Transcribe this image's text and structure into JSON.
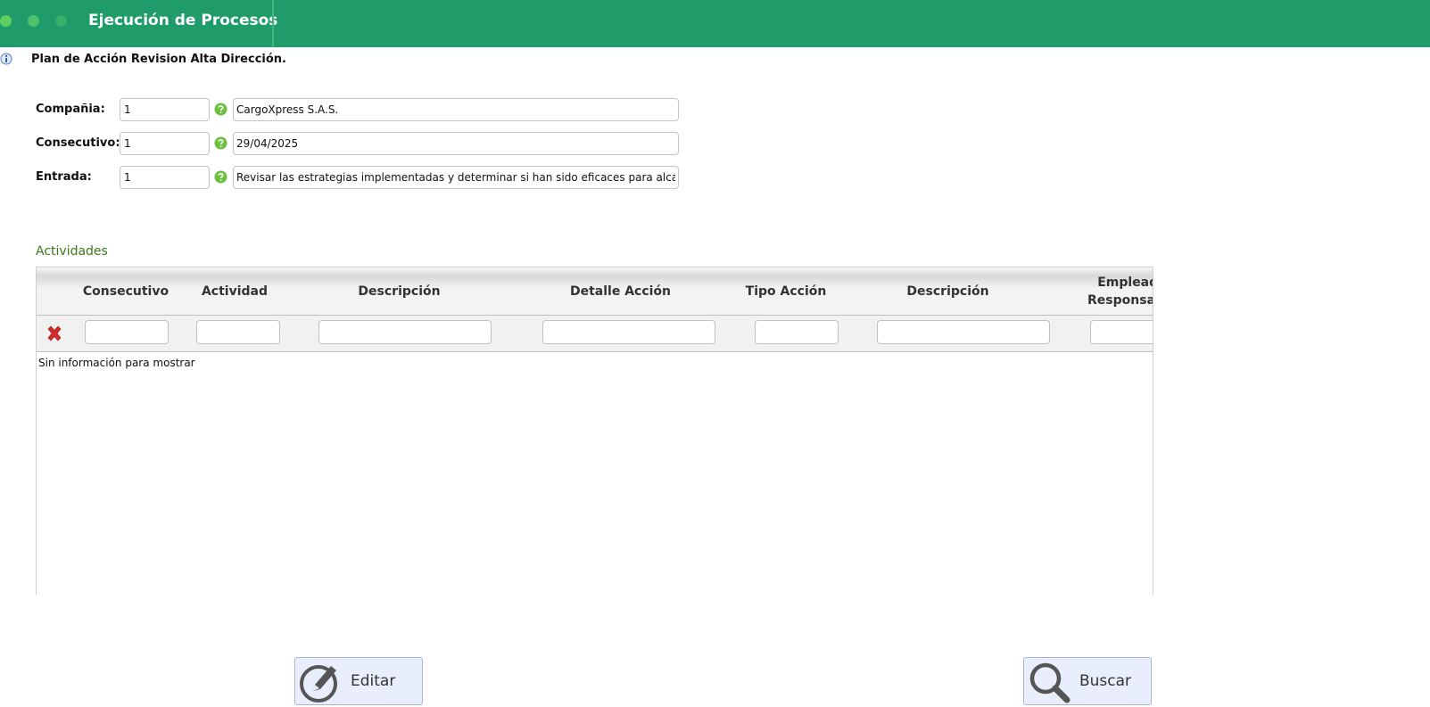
{
  "header": {
    "title": "Ejecución de Procesos"
  },
  "page": {
    "subtitle": "Plan de Acción Revision Alta Dirección."
  },
  "form": {
    "company": {
      "label": "Compañia:",
      "code": "1",
      "description": "CargoXpress S.A.S."
    },
    "consecutive": {
      "label": "Consecutivo:",
      "code": "1",
      "description": "29/04/2025"
    },
    "entry": {
      "label": "Entrada:",
      "code": "1",
      "description": "Revisar las estrategias implementadas y determinar si han sido eficaces para alcanza"
    }
  },
  "activities": {
    "title": "Actividades",
    "columns": [
      "Consecutivo",
      "Actividad",
      "Descripción",
      "Detalle Acción",
      "Tipo Acción",
      "Descripción",
      "Empleado Responsable"
    ],
    "empty_message": "Sin información para mostrar"
  },
  "buttons": {
    "edit": "Editar",
    "search": "Buscar"
  },
  "colors": {
    "header": "#1f9c6a",
    "section_title": "#3a7a1a",
    "button_bg": "#e8eefb"
  }
}
